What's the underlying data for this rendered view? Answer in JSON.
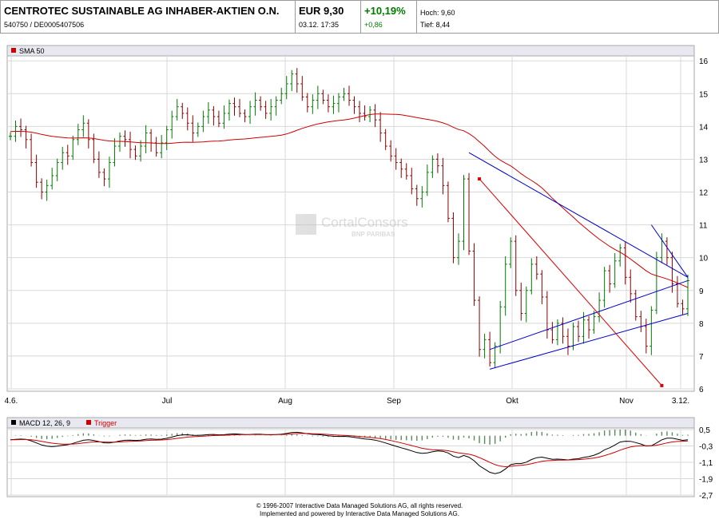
{
  "header": {
    "name": "CENTROTEC SUSTAINABLE AG INHABER-AKTIEN O.N.",
    "ids": "540750  /  DE0005407506",
    "price": "EUR 9,30",
    "datetime": "03.12. 17:35",
    "change_pct": "+10,19%",
    "change_abs": "+0,86",
    "high": "Hoch: 9,60",
    "low": "Tief: 8,44"
  },
  "watermark": {
    "brand": "CortalConsors",
    "sub": "BNP PARIBAS"
  },
  "footer": {
    "line1": "© 1996-2007 Interactive Data Managed Solutions AG, all rights reserved.",
    "line2": "Implemented and powered by Interactive Data Managed Solutions AG."
  },
  "colors": {
    "up": "#007a00",
    "down": "#8b0000",
    "sma": "#cc0000",
    "trend_blue": "#0000cc",
    "trend_red": "#dd0000",
    "macd": "#000000",
    "trigger": "#cc0000",
    "hist": "#5a8a5a"
  },
  "chart_data": [
    {
      "type": "ohlc",
      "legend": [
        "SMA 50"
      ],
      "x_labels": [
        "4.6.",
        "Jul",
        "Aug",
        "Sep",
        "Okt",
        "Nov",
        "3.12."
      ],
      "y_ticks": [
        6,
        7,
        8,
        9,
        10,
        11,
        12,
        13,
        14,
        15,
        16
      ],
      "ylim": [
        6,
        16.2
      ],
      "grid": true,
      "close": [
        13.7,
        14.0,
        13.9,
        13.6,
        12.9,
        12.3,
        12.0,
        12.2,
        12.5,
        12.9,
        13.2,
        13.1,
        13.6,
        13.9,
        14.1,
        13.6,
        13.0,
        12.6,
        12.4,
        12.9,
        13.4,
        13.7,
        13.6,
        13.3,
        13.1,
        13.4,
        13.8,
        13.5,
        13.2,
        13.5,
        13.9,
        14.3,
        14.6,
        14.4,
        14.1,
        13.8,
        14.0,
        14.3,
        14.5,
        14.3,
        14.1,
        14.4,
        14.7,
        14.6,
        14.4,
        14.3,
        14.6,
        14.8,
        14.6,
        14.4,
        14.6,
        14.8,
        15.0,
        15.3,
        15.6,
        15.3,
        14.9,
        14.6,
        14.8,
        15.0,
        14.8,
        14.6,
        14.7,
        14.9,
        15.0,
        14.8,
        14.6,
        14.4,
        14.3,
        14.5,
        14.2,
        13.8,
        13.4,
        13.1,
        12.9,
        12.7,
        12.5,
        12.1,
        11.8,
        12.0,
        12.6,
        13.0,
        12.8,
        12.2,
        11.2,
        10.0,
        10.5,
        12.4,
        10.2,
        8.7,
        7.2,
        7.5,
        6.8,
        7.3,
        8.5,
        9.8,
        10.5,
        9.0,
        8.3,
        9.0,
        9.8,
        9.5,
        8.8,
        7.8,
        7.5,
        8.0,
        7.6,
        7.3,
        7.9,
        7.6,
        8.1,
        7.8,
        8.2,
        8.7,
        9.6,
        9.2,
        9.9,
        10.3,
        9.4,
        8.9,
        8.2,
        7.9,
        7.3,
        8.4,
        10.0,
        10.5,
        10.0,
        9.2,
        8.6,
        8.44,
        9.3
      ]
    },
    {
      "type": "line",
      "legend": [
        "MACD 12, 26, 9",
        "Trigger"
      ],
      "y_ticks": [
        0.5,
        -0.3,
        -1.1,
        -1.9,
        -2.7
      ],
      "y_tick_labels": [
        "0,5",
        "-0,3",
        "-1,1",
        "-1,9",
        "-2,7"
      ],
      "ylim": [
        -2.7,
        0.5
      ]
    }
  ]
}
